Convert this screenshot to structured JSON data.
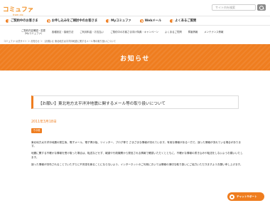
{
  "header": {
    "logo_text": "コミュファ",
    "logo_sub": "from ctc",
    "search_placeholder": "サイト内を検索"
  },
  "main_nav": {
    "items": [
      {
        "label": "ご契約中のお客さま"
      },
      {
        "label": "お申し込みをご検討中のお客さま"
      },
      {
        "label": "Myコミュファ"
      },
      {
        "label": "Webメール"
      },
      {
        "label": "よくあるご質問"
      }
    ]
  },
  "sub_nav": {
    "items": [
      {
        "label": "ご契約内容確認・変更\n（Myコミュファ）"
      },
      {
        "label": "各種設定・接続方法"
      },
      {
        "label": "ご利用料金・お支払い"
      },
      {
        "label": "ご契約中のお客さま向け特典・キャンペーン"
      },
      {
        "label": "よくあるご質問"
      },
      {
        "label": "障害情報"
      },
      {
        "label": "メンテナンス情報"
      }
    ]
  },
  "breadcrumb": "コミュファ 公式サイト ＞ お知らせ ＞ 【お願い】東北地方太平洋沖地震に関するメール等の取り扱いについて",
  "banner": {
    "title": "お知らせ"
  },
  "article": {
    "title": "【お願い】東北地方太平洋沖地震に関するメール等の取り扱いについて",
    "date": "2011年3月18日",
    "tag": "その他",
    "paragraphs": [
      "東北地方太平洋沖地震の発生後、電子メール、電子掲示板、ツイッター、ブログ等で さまざまな情報が流れています。有用な情報がある一方で、誤った情報が流れている場合があります。",
      "地震に関する不確かな情報を受け取った場合は、転送などせず、報道や行政機関から発信される情報で確認いただくとともに、不確かな情報の書き込みや転送をしないようお願いいたします。",
      "誤った情報が流布されることでいたずらに不安感を煽ることにならないよう、インターネットのご利用においては情報の適切な取り扱いにご協力いただきますようお願い申し上げます。"
    ]
  },
  "chat": {
    "label": "チャットサポート"
  },
  "colors": {
    "accent": "#ef7d1f"
  }
}
